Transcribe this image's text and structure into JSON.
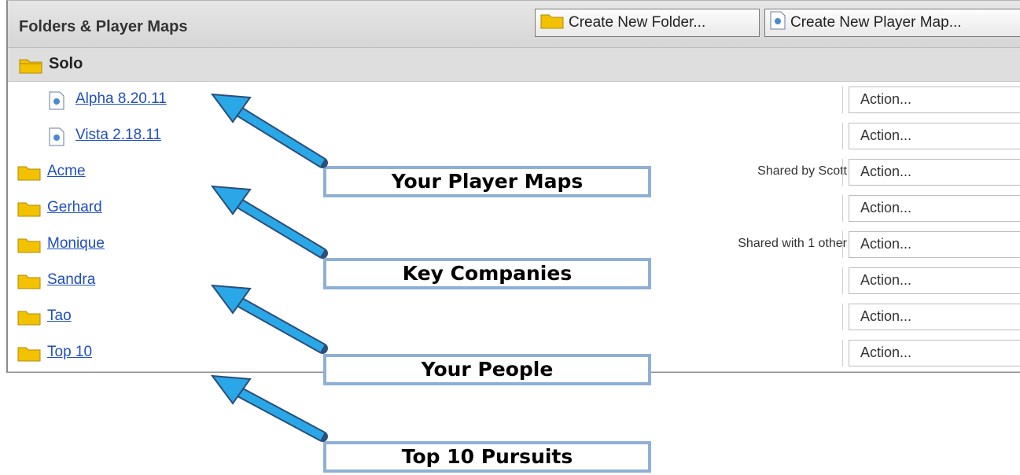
{
  "header": {
    "title": "Folders & Player Maps",
    "create_folder_label": "Create New Folder...",
    "create_map_label": "Create New Player Map..."
  },
  "group": {
    "label": "Solo"
  },
  "rows": [
    {
      "type": "map",
      "name": "Alpha 8.20.11",
      "note": "",
      "action": "Action..."
    },
    {
      "type": "map",
      "name": "Vista 2.18.11",
      "note": "",
      "action": "Action..."
    },
    {
      "type": "folder",
      "name": "Acme",
      "note": "Shared by Scott",
      "action": "Action..."
    },
    {
      "type": "folder",
      "name": "Gerhard",
      "note": "",
      "action": "Action..."
    },
    {
      "type": "folder",
      "name": "Monique",
      "note": "Shared with 1 other",
      "action": "Action..."
    },
    {
      "type": "folder",
      "name": "Sandra",
      "note": "",
      "action": "Action..."
    },
    {
      "type": "folder",
      "name": "Tao",
      "note": "",
      "action": "Action..."
    },
    {
      "type": "folder",
      "name": "Top 10",
      "note": "",
      "action": "Action..."
    }
  ],
  "callouts": [
    "Your Player Maps",
    "Key Companies",
    "Your People",
    "Top 10 Pursuits"
  ],
  "colors": {
    "link": "#1f4fbf",
    "folder": "#f2c200",
    "arrow": "#2aa7e6",
    "callout_border": "#8fb0d6"
  },
  "icons": {
    "folder": "folder-icon",
    "map": "player-map-icon"
  }
}
